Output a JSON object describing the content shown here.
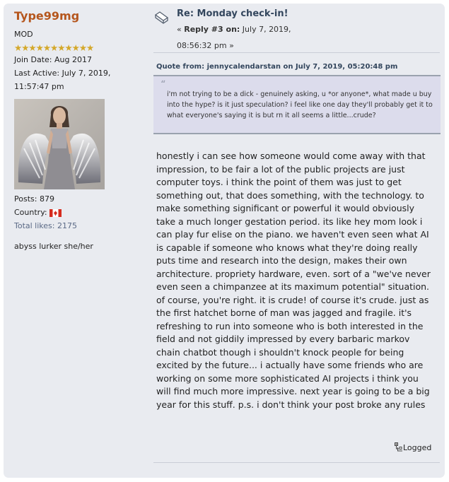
{
  "poster": {
    "username": "Type99mg",
    "role": "MOD",
    "stars": "★★★★★★★★★★★",
    "join_date": "Join Date: Aug 2017",
    "last_active_1": "Last Active: July 7, 2019,",
    "last_active_2": "11:57:47 pm",
    "posts": "Posts: 879",
    "country": "Country:",
    "likes": "Total likes: 2175",
    "blurb": "abyss lurker she/her"
  },
  "post": {
    "subject": "Re: Monday check-in!",
    "meta_prefix": "« ",
    "reply_label": "Reply #3 on:",
    "date_1": " July 7, 2019,",
    "date_2": "08:56:32 pm »",
    "quote_header": "Quote from: jennycalendarstan on July 7, 2019, 05:20:48 pm",
    "quote_text": "i'm not trying to be a dick - genuinely asking, u *or anyone*, what made u buy into the hype? is it just speculation? i feel like one day they'll probably get it to what everyone's saying it is but rn it all seems a little...crude?",
    "body": "honestly i can see how someone would come away with that impression, to be fair a lot of the public projects are just computer toys. i think the point of them was just to get something out, that does something, with the technology. to make something significant or powerful it would obviously take a much longer gestation period. its like hey mom look i can play fur elise on the piano. we haven't even seen what AI is capable if someone who knows what they're doing really puts time and research into the design, makes their own architecture. propriety hardware, even. sort of a \"we've never even seen a chimpanzee at its maximum potential\" situation. of course, you're right. it is crude! of course it's crude. just as the first hatchet borne of man was jagged and fragile. it's refreshing to run into someone who is both interested in the field and not giddily impressed by every barbaric markov chain chatbot though i shouldn't knock people for being excited by the future... i actually have some friends who are working on some more sophisticated AI projects i think you will find much more impressive. next year is going to be a big year for this stuff. p.s. i don't think your post broke any rules",
    "logged": "Logged"
  },
  "colors": {
    "username": "#b5561d",
    "subject": "#33465d",
    "panel": "#e9ebf0",
    "quote_bg": "#dcdcec"
  },
  "icons": {
    "topic": "topic-tag-icon",
    "flag": "canada-flag-icon",
    "logged": "ip-logged-icon",
    "quote": "quote-mark-icon"
  }
}
